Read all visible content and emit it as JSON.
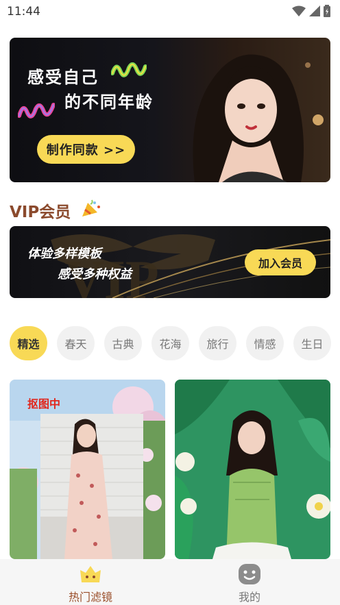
{
  "status_bar": {
    "time": "11:44"
  },
  "banner": {
    "line1": "感受自己",
    "line2": "的不同年龄",
    "button": "制作同款 >>"
  },
  "vip": {
    "title": "VIP会员",
    "line1": "体验多样模板",
    "line2": "感受多种权益",
    "join_button": "加入会员"
  },
  "categories": [
    "精选",
    "春天",
    "古典",
    "花海",
    "旅行",
    "情感",
    "生日"
  ],
  "selected_category": "精选",
  "cards": [
    {
      "status": "抠图中"
    },
    {
      "status": ""
    }
  ],
  "bottom_nav": {
    "items": [
      {
        "label": "热门滤镜",
        "active": true
      },
      {
        "label": "我的",
        "active": false
      }
    ]
  },
  "colors": {
    "accent_yellow": "#f8d956",
    "vip_brown": "#8b4a2d",
    "nav_active": "#9a4e2a",
    "processing_red": "#e1261c"
  }
}
